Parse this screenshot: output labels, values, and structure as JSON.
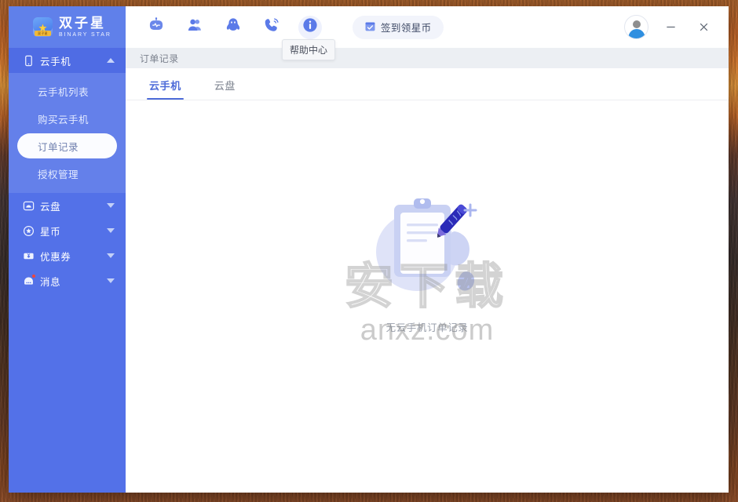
{
  "app": {
    "logo_cn": "双子星",
    "logo_en": "BINARY STAR"
  },
  "sidebar": {
    "groups": [
      {
        "label": "云手机",
        "icon": "phone-icon",
        "expanded": true,
        "items": [
          {
            "label": "云手机列表",
            "active": false
          },
          {
            "label": "购买云手机",
            "active": false
          },
          {
            "label": "订单记录",
            "active": true
          },
          {
            "label": "授权管理",
            "active": false
          }
        ]
      },
      {
        "label": "云盘",
        "icon": "cloud-disk-icon",
        "expanded": false,
        "items": []
      },
      {
        "label": "星币",
        "icon": "star-coin-icon",
        "expanded": false,
        "items": []
      },
      {
        "label": "优惠券",
        "icon": "coupon-icon",
        "expanded": false,
        "items": []
      },
      {
        "label": "消息",
        "icon": "message-icon",
        "expanded": false,
        "items": [],
        "badge": true
      }
    ]
  },
  "toolbar": {
    "icons": [
      {
        "name": "robot-icon",
        "active": false
      },
      {
        "name": "friends-icon",
        "active": false
      },
      {
        "name": "qq-penguin-icon",
        "active": false
      },
      {
        "name": "qq-phone-icon",
        "active": false
      },
      {
        "name": "info-icon",
        "active": true
      }
    ],
    "signin_label": "签到领星币",
    "signin_icon": "calendar-check-icon",
    "tooltip": "帮助中心",
    "minimize_label": "—",
    "close_label": "✕"
  },
  "breadcrumb": {
    "text": "订单记录"
  },
  "tabs": [
    {
      "label": "云手机",
      "active": true
    },
    {
      "label": "云盘",
      "active": false
    }
  ],
  "empty_state": {
    "text": "无云手机订单记录",
    "illustration": "clipboard-pencil-illustration"
  },
  "watermark": {
    "cn": "安下载",
    "en": "anxz.com"
  },
  "colors": {
    "sidebar_bg": "#5371e8",
    "sidebar_sub_bg": "#6480ea",
    "accent": "#4d6bd8",
    "crumb_bg": "#eceff3",
    "badge": "#f0453a"
  }
}
